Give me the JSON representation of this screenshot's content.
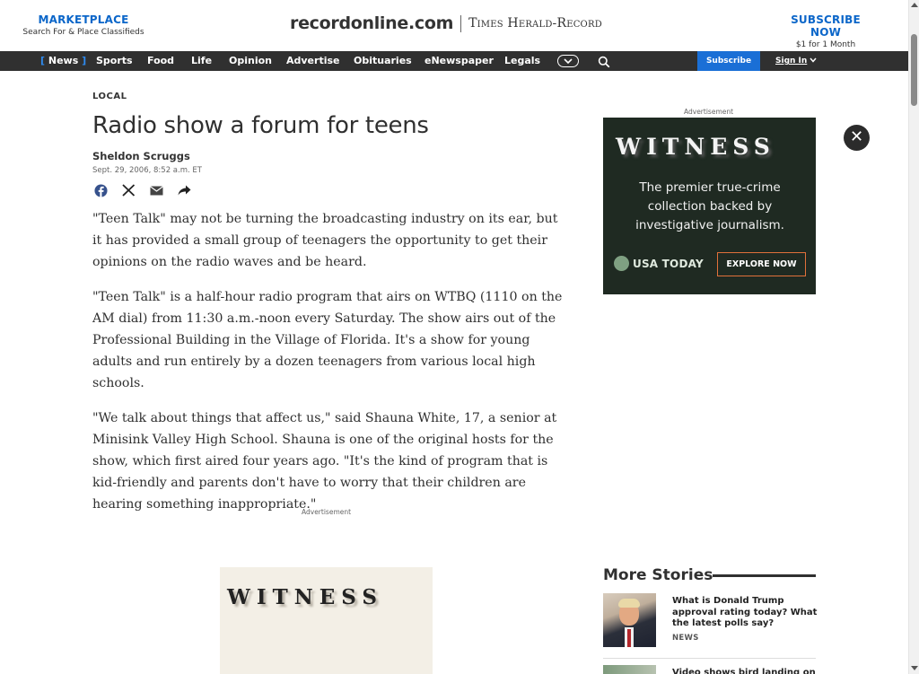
{
  "header": {
    "marketplace_title": "MARKETPLACE",
    "marketplace_sub": "Search For & Place Classifieds",
    "site_name": "recordonline.com",
    "paper_name": "Times Herald-Record",
    "subscribe_title": "SUBSCRIBE NOW",
    "subscribe_sub": "$1 for 1 Month"
  },
  "nav": {
    "items": [
      {
        "label": "News",
        "active": true
      },
      {
        "label": "Sports"
      },
      {
        "label": "Food"
      },
      {
        "label": "Life"
      },
      {
        "label": "Opinion"
      },
      {
        "label": "Advertise"
      },
      {
        "label": "Obituaries"
      },
      {
        "label": "eNewspaper"
      },
      {
        "label": "Legals"
      }
    ],
    "bracket_open": "[",
    "bracket_close": "]",
    "subscribe_label": "Subscribe",
    "signin_label": "Sign In",
    "icons": [
      "chevron-down-icon",
      "search-icon"
    ],
    "accent_color": "#1a6fd6"
  },
  "article": {
    "section": "LOCAL",
    "headline": "Radio show a forum for teens",
    "author": "Sheldon Scruggs",
    "date": "Sept. 29, 2006, 8:52 a.m. ET",
    "share_icons": [
      "facebook-icon",
      "x-icon",
      "email-icon",
      "share-icon"
    ],
    "paragraphs": [
      "\"Teen Talk\" may not be turning the broadcasting industry on its ear, but it has provided a small group of teenagers the opportunity to get their opinions on the radio waves and be heard.",
      "\"Teen Talk\" is a half-hour radio program that airs on WTBQ (1110 on the AM dial) from 11:30 a.m.-noon every Saturday. The show airs out of the Professional Building in the Village of Florida. It's a show for young adults and run entirely by a dozen teenagers from various local high schools.",
      "\"We talk about things that affect us,\" said Shauna White, 17, a senior at Minisink Valley High School. Shauna is one of the original hosts for the show, which first aired four years ago. \"It's the kind of program that is kid-friendly and parents don't have to worry that their children are hearing something inappropriate.\""
    ]
  },
  "ads": {
    "label": "Advertisement",
    "right": {
      "title": "WITNESS",
      "copy": "The premier true-crime collection backed by investigative journalism.",
      "logo": "USA TODAY",
      "cta": "EXPLORE NOW"
    },
    "mid": {
      "title": "WITNESS"
    },
    "close_symbol": "✕"
  },
  "more_stories": {
    "title": "More Stories",
    "stories": [
      {
        "title": "What is Donald Trump approval rating today? What the latest polls say?",
        "tag": "NEWS"
      },
      {
        "title": "Video shows bird landing on",
        "tag": ""
      }
    ]
  }
}
